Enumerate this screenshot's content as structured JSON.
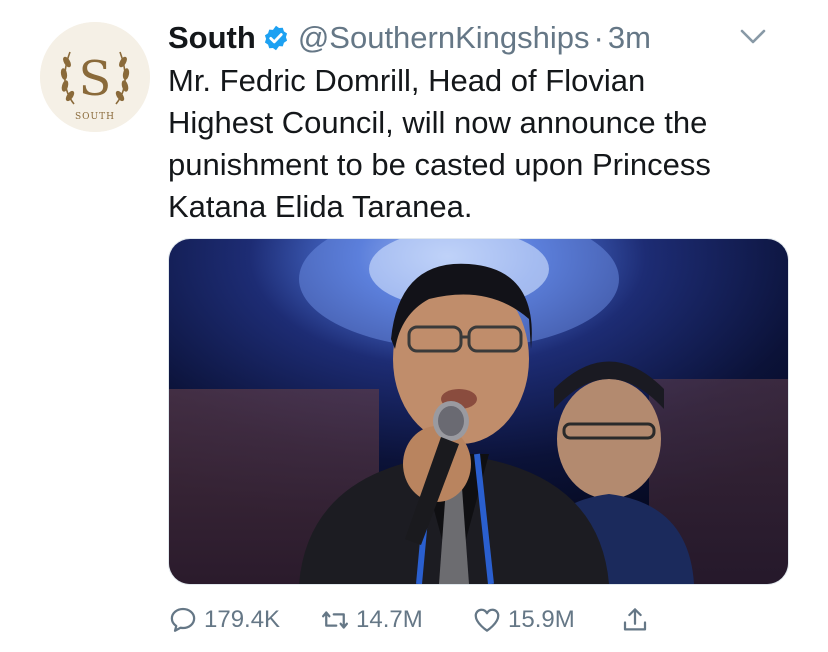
{
  "account": {
    "avatar_text": "SOUTH",
    "avatar_letter": "S",
    "display_name": "South",
    "handle": "@SouthernKingships",
    "separator": "·",
    "time": "3m"
  },
  "tweet": {
    "text": "Mr. Fedric Domrill, Head of Flovian\nHighest Council, will now announce the\npunishment to be casted upon Princess\nKatana Elida Taranea."
  },
  "actions": {
    "replies": "179.4K",
    "retweets": "14.7M",
    "likes": "15.9M"
  },
  "icons": {
    "verified": "verified-badge-icon",
    "caret": "chevron-down-icon",
    "reply": "reply-icon",
    "retweet": "retweet-icon",
    "like": "heart-icon",
    "share": "share-icon"
  },
  "colors": {
    "verified_blue": "#1da1f2",
    "muted": "#657786",
    "gold": "#8a6a3a"
  }
}
